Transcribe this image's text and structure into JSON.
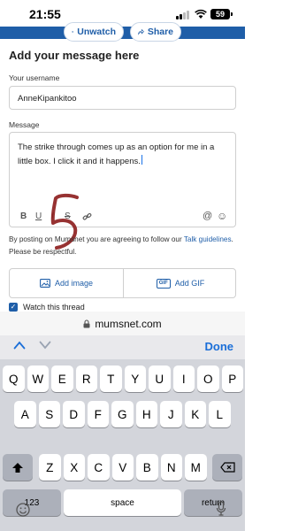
{
  "status_bar": {
    "time": "21:55",
    "battery": "59"
  },
  "header": {
    "unwatch_label": "Unwatch",
    "share_label": "Share"
  },
  "form": {
    "title": "Add your message here",
    "username_label": "Your username",
    "username_value": "AnneKipankitoo",
    "message_label": "Message",
    "message_value": "The strike through comes up as an option for me in a little box. I click it and it happens."
  },
  "format_toolbar": {
    "bold": "B",
    "underline": "U",
    "italic": "I",
    "strikethrough": "S"
  },
  "terms": {
    "prefix": "By posting on Mumsnet you are agreeing to follow our ",
    "link": "Talk guidelines",
    "suffix": ". Please be respectful."
  },
  "attachments": {
    "add_image": "Add image",
    "add_gif": "Add GIF",
    "gif_badge": "GIF"
  },
  "watch_thread": {
    "label": "Watch this thread",
    "checked": true
  },
  "browser": {
    "url": "mumsnet.com"
  },
  "accessory": {
    "done_label": "Done"
  },
  "keyboard": {
    "row1": [
      "Q",
      "W",
      "E",
      "R",
      "T",
      "Y",
      "U",
      "I",
      "O",
      "P"
    ],
    "row2": [
      "A",
      "S",
      "D",
      "F",
      "G",
      "H",
      "J",
      "K",
      "L"
    ],
    "row3": [
      "Z",
      "X",
      "C",
      "V",
      "B",
      "N",
      "M"
    ],
    "numbers_key": "123",
    "space_key": "space",
    "return_key": "return"
  },
  "colors": {
    "brand": "#1f5ea8",
    "done": "#1a6ed8",
    "keyboard_bg": "#d3d5db"
  }
}
